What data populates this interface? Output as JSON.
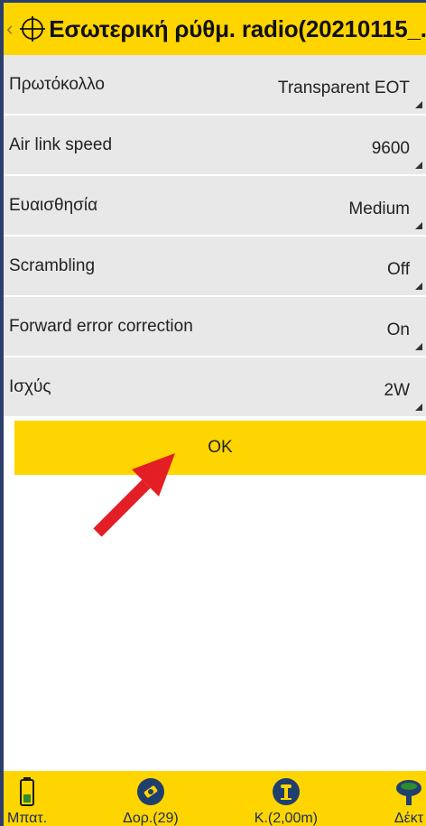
{
  "header": {
    "back_icon": "chevron-left-icon",
    "crosshair_icon": "crosshair-icon",
    "title": "Εσωτερική ρύθμ. radio(20210115_..."
  },
  "settings": [
    {
      "label": "Πρωτόκολλο",
      "value": "Transparent EOT"
    },
    {
      "label": "Air link speed",
      "value": "9600"
    },
    {
      "label": "Ευαισθησία",
      "value": "Medium"
    },
    {
      "label": "Scrambling",
      "value": "Off"
    },
    {
      "label": "Forward error correction",
      "value": "On"
    },
    {
      "label": "Ισχύς",
      "value": "2W"
    }
  ],
  "ok_label": "OK",
  "annotation": {
    "color": "#e31e24"
  },
  "colors": {
    "accent": "#ffd500",
    "row_bg": "#e8e8e8",
    "frame": "#2c3e6c"
  },
  "bottom_bar": [
    {
      "label": "Μπατ.",
      "icon": "battery-icon"
    },
    {
      "label": "Δορ.(29)",
      "icon": "satellite-icon"
    },
    {
      "label": "Κ.(2,00m)",
      "icon": "rover-icon"
    },
    {
      "label": "Δέκτ",
      "icon": "receiver-icon"
    }
  ]
}
